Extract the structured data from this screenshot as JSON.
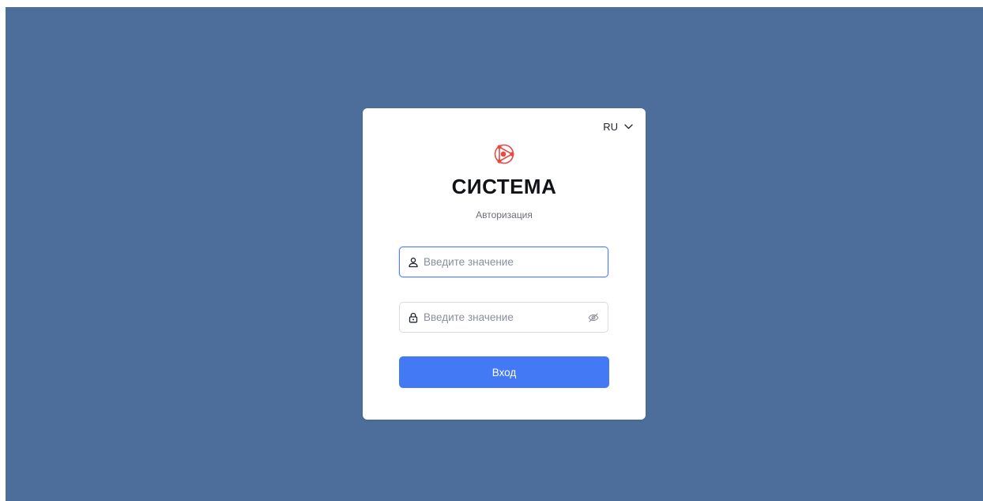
{
  "language": {
    "current": "RU"
  },
  "brand": {
    "name": "СИСТЕМА",
    "subtitle": "Авторизация",
    "logo_color": "#e84a3f"
  },
  "login_form": {
    "username": {
      "value": "",
      "placeholder": "Введите значение",
      "icon": "user-icon"
    },
    "password": {
      "value": "",
      "placeholder": "Введите значение",
      "icon": "lock-icon",
      "toggle_icon": "eye-off-icon"
    },
    "submit_label": "Вход"
  },
  "colors": {
    "background": "#4d6e9b",
    "card": "#ffffff",
    "accent": "#4479f5",
    "focus_border": "#4d7cf6"
  }
}
